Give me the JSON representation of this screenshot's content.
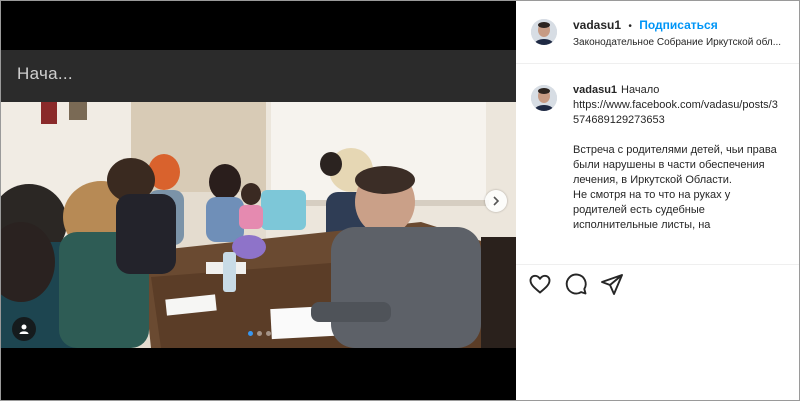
{
  "media": {
    "caption_overlay": "Нача..."
  },
  "post": {
    "username": "vadasu1",
    "separator": "•",
    "follow_label": "Подписаться",
    "location": "Законодательное Собрание Иркутской обл..."
  },
  "caption": {
    "username": "vadasu1",
    "first_word": "Начало",
    "link": "https://www.facebook.com/vadasu/posts/3574689129273653",
    "paragraph1": "Встреча с родителями детей, чьи права были нарушены в части обеспечения лечения, в Иркутской Области.",
    "paragraph2": "Не смотря на то что на руках у родителей есть судебные исполнительные листы, на"
  },
  "icons": {
    "like": "heart-icon",
    "comment": "comment-icon",
    "share": "share-icon",
    "next": "chevron-right-icon",
    "mute": "user-tag-icon"
  },
  "colors": {
    "accent": "#0095f6",
    "carousel_active": "#3897f0"
  }
}
